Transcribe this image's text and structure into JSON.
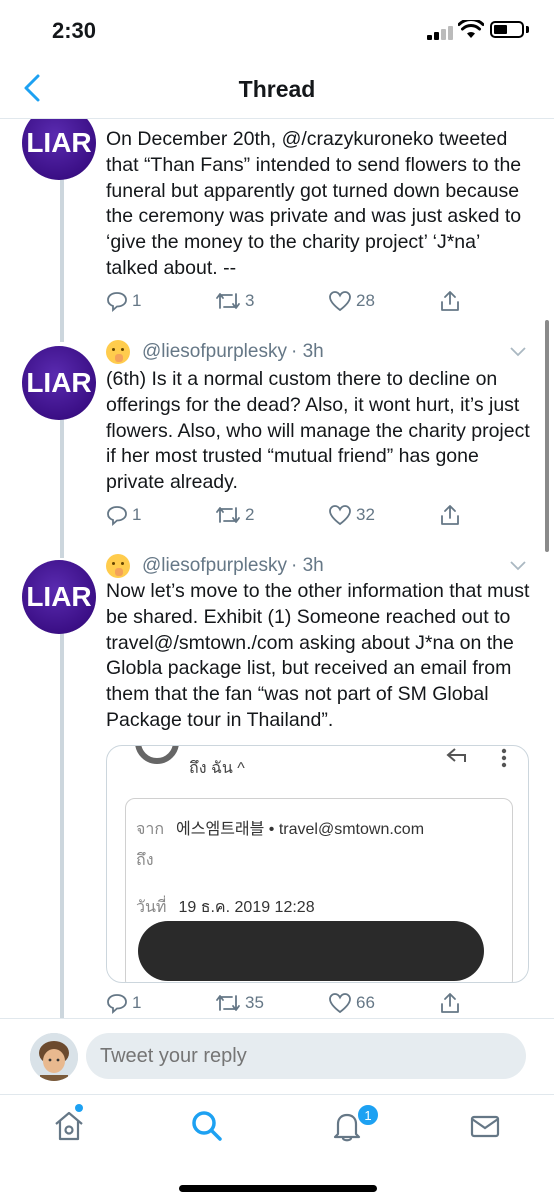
{
  "status_bar": {
    "time": "2:30"
  },
  "nav": {
    "title": "Thread"
  },
  "tweets": [
    {
      "avatar_text": "LIAR",
      "text": "On December 20th, @/crazykuroneko tweeted that “Than Fans” intended to send flowers to the funeral but apparently got turned down because the ceremony was private and was just asked to ‘give the money to the charity project’ ‘J*na’ talked about. --",
      "replies": "1",
      "retweets": "3",
      "likes": "28"
    },
    {
      "avatar_text": "LIAR",
      "handle": "@liesofpurplesky",
      "time": "· 3h",
      "text": "(6th) Is it a normal custom there to decline on offerings for the dead? Also, it wont hurt, it’s just flowers. Also, who will manage the charity project if her most trusted “mutual friend” has gone private already.",
      "replies": "1",
      "retweets": "2",
      "likes": "32"
    },
    {
      "avatar_text": "LIAR",
      "handle": "@liesofpurplesky",
      "time": "· 3h",
      "text": "Now let’s move to the other information that must be shared. Exhibit (1) Someone reached out to travel@/smtown./com asking about J*na on the Globla package list, but received an email from them that the fan “was not part of SM Global Package tour in Thailand”.",
      "replies": "1",
      "retweets": "35",
      "likes": "66",
      "media": {
        "recipient_header": "ถึง ฉัน ^",
        "from_label": "จาก",
        "from_value": "에스엠트래블 • travel@smtown.com",
        "to_label": "ถึง",
        "date_label": "วันที่",
        "date_value": "19 ธ.ค. 2019 12:28"
      }
    }
  ],
  "reply_bar": {
    "placeholder": "Tweet your reply"
  },
  "tab_bar": {
    "notifications_badge": "1"
  },
  "colors": {
    "accent": "#1da1f2",
    "avatar": "#3b0f86",
    "text_secondary": "#657786"
  }
}
